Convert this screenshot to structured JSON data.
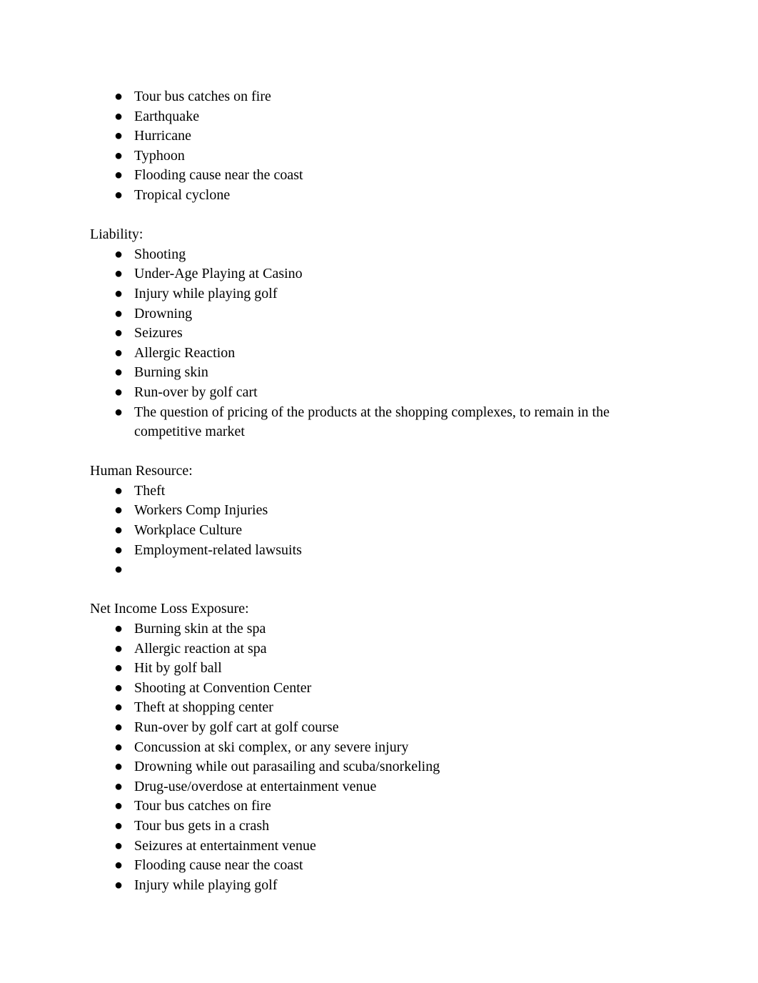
{
  "document": {
    "bullet_glyph": "●",
    "text_color": "#000000",
    "background_color": "#ffffff",
    "sections": [
      {
        "id": "property-continued",
        "heading": null,
        "items": [
          "Tour bus catches on fire",
          "Earthquake",
          "Hurricane",
          "Typhoon",
          "Flooding cause near the coast",
          "Tropical cyclone"
        ]
      },
      {
        "id": "liability",
        "heading": "Liability:",
        "items": [
          "Shooting",
          "Under-Age Playing at Casino",
          "Injury while playing golf",
          "Drowning",
          "Seizures",
          "Allergic Reaction",
          "Burning skin",
          "Run-over by golf cart",
          "The question of pricing of the products at the shopping complexes, to remain in the competitive market"
        ]
      },
      {
        "id": "human-resource",
        "heading": "Human Resource:",
        "items": [
          "Theft",
          "Workers Comp Injuries",
          "Workplace Culture",
          "Employment-related lawsuits",
          ""
        ]
      },
      {
        "id": "net-income-loss-exposure",
        "heading": "Net Income Loss Exposure:",
        "items": [
          "Burning skin at the spa",
          "Allergic reaction at spa",
          "Hit by golf ball",
          "Shooting at Convention Center",
          "Theft at shopping center",
          "Run-over by golf cart at golf course",
          "Concussion at ski complex, or any severe injury",
          "Drowning while out parasailing and scuba/snorkeling",
          "Drug-use/overdose at entertainment venue",
          "Tour bus catches on fire",
          "Tour bus gets in a crash",
          "Seizures at entertainment venue",
          "Flooding cause near the coast",
          "Injury while playing golf"
        ]
      }
    ]
  }
}
